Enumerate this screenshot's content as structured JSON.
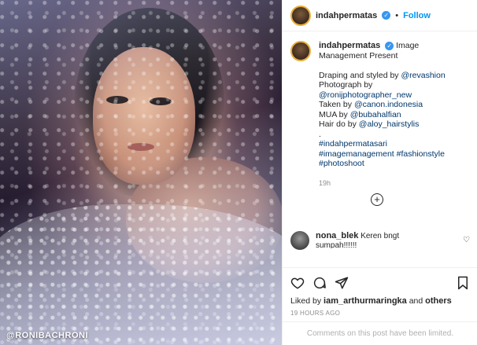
{
  "photo": {
    "watermark": "@RONIBACHRONI"
  },
  "header": {
    "username": "indahpermatas",
    "separator": "•",
    "follow_label": "Follow"
  },
  "caption": {
    "username": "indahpermatas",
    "lines": [
      "Image Management Present",
      "",
      "Draping and styled by @revashion",
      "Photograph by",
      "@ronijphotographer_new",
      "Taken by @canon.indonesia",
      "MUA by @bubahalfian",
      "Hair do by @aloy_hairstylis",
      ".",
      "#indahpermatasari",
      "#imagemanagement #fashionstyle",
      "#photoshoot"
    ],
    "line1_text": "Image",
    "line2_text": "Management Present",
    "draping_prefix": "Draping and styled by ",
    "draping_link": "@revashion",
    "photograph_label": "Photograph by",
    "photographer_link": "@ronijphotographer_new",
    "taken_prefix": "Taken by ",
    "taken_link": "@canon.indonesia",
    "mua_prefix": "MUA by ",
    "mua_link": "@bubahalfian",
    "hair_prefix": "Hair do by ",
    "hair_link": "@aloy_hairstylis",
    "dot": ".",
    "tag_line1": "#indahpermatasari",
    "tag_line2": "#imagemanagement #fashionstyle",
    "tag_line3": "#photoshoot",
    "time": "19h"
  },
  "more_comments": {
    "icon": "plus-circle-icon"
  },
  "comment": {
    "username": "nona_blek",
    "text": "Keren bngt sumpah!!!!!!"
  },
  "actions": {
    "likes_prefix": "Liked by ",
    "likes_user": "iam_arthurmaringka",
    "likes_suffix": " and ",
    "likes_others": "others",
    "posted_ago": "19 HOURS AGO"
  },
  "footer": {
    "limited_text": "Comments on this post have been limited."
  },
  "colors": {
    "accent": "#0095f6",
    "verified": "#3897f0",
    "link": "#00376b",
    "muted": "#8e8e8e",
    "border": "#efefef"
  }
}
